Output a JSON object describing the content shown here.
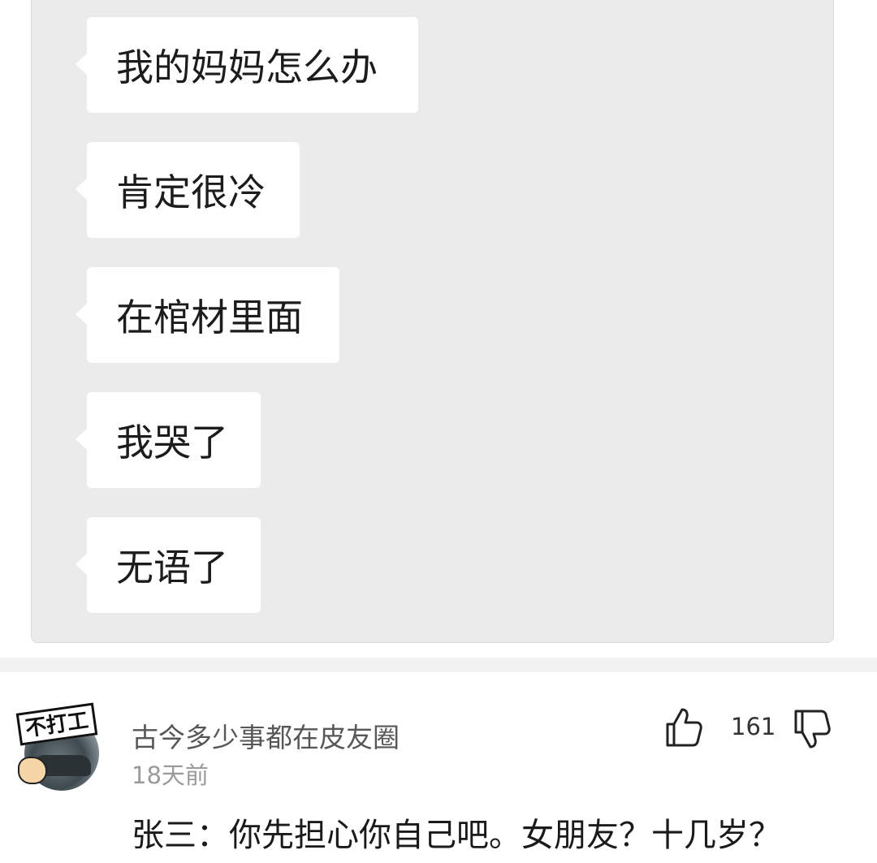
{
  "chat": {
    "messages": [
      {
        "text": "我的妈妈怎么办"
      },
      {
        "text": "肯定很冷"
      },
      {
        "text": "在棺材里面"
      },
      {
        "text": "我哭了"
      },
      {
        "text": "无语了"
      }
    ]
  },
  "comment": {
    "avatar_text": "不打工",
    "username": "古今多少事都在皮友圈",
    "time": "18天前",
    "text": "张三：你先担心你自己吧。女朋友？十几岁？",
    "likes": "161",
    "icons": {
      "like": "thumbs-up-icon",
      "dislike": "thumbs-down-icon"
    }
  },
  "colors": {
    "chat_background": "#ebebeb",
    "bubble": "#ffffff",
    "username": "#575757",
    "time": "#9a9a9a"
  }
}
